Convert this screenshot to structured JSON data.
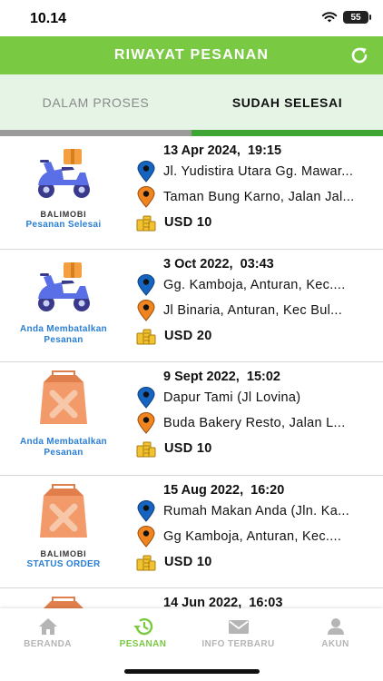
{
  "status_bar": {
    "time": "10.14",
    "battery": "55"
  },
  "header": {
    "title": "RIWAYAT PESANAN",
    "refresh_icon": "refresh-icon"
  },
  "tabs": [
    {
      "label": "DALAM PROSES",
      "active": false
    },
    {
      "label": "SUDAH SELESAI",
      "active": true
    }
  ],
  "colors": {
    "brand_green": "#7ac943",
    "status_blue": "#2a7fd4",
    "pin_blue": "#1564c0",
    "pin_orange": "#f0841e"
  },
  "orders": [
    {
      "icon": "scooter-icon",
      "brand": "BALIMOBI",
      "status": "Pesanan Selesai",
      "datetime": "13 Apr 2024,  19:15",
      "pickup": "Jl. Yudistira Utara Gg. Mawar...",
      "dropoff": "Taman Bung Karno,  Jalan Jal...",
      "price": "USD 10"
    },
    {
      "icon": "scooter-icon",
      "brand": "",
      "status": "Anda Membatalkan Pesanan",
      "datetime": "3 Oct 2022,  03:43",
      "pickup": "Gg. Kamboja, Anturan, Kec....",
      "dropoff": "Jl  Binaria, Anturan, Kec  Bul...",
      "price": "USD 20"
    },
    {
      "icon": "food-bag-icon",
      "brand": "",
      "status": "Anda Membatalkan Pesanan",
      "datetime": "9 Sept 2022,  15:02",
      "pickup": "Dapur Tami (Jl Lovina)",
      "dropoff": "Buda Bakery Resto,  Jalan L...",
      "price": "USD 10"
    },
    {
      "icon": "food-bag-icon",
      "brand": "BALIMOBI",
      "status": "STATUS ORDER",
      "datetime": "15 Aug 2022,  16:20",
      "pickup": "Rumah Makan Anda (Jln. Ka...",
      "dropoff": "Gg  Kamboja, Anturan, Kec....",
      "price": "USD 10"
    },
    {
      "icon": "food-bag-icon",
      "brand": "",
      "status": "",
      "datetime": "14 Jun 2022,  16:03",
      "pickup": "",
      "dropoff": "",
      "price": ""
    }
  ],
  "bottom_nav": [
    {
      "label": "BERANDA",
      "icon": "home-icon",
      "active": false
    },
    {
      "label": "PESANAN",
      "icon": "history-icon",
      "active": true
    },
    {
      "label": "INFO TERBARU",
      "icon": "mail-icon",
      "active": false
    },
    {
      "label": "AKUN",
      "icon": "user-icon",
      "active": false
    }
  ]
}
